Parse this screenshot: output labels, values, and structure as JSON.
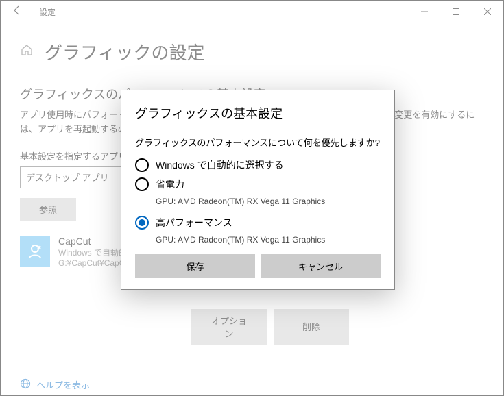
{
  "titlebar": {
    "title": "設定"
  },
  "page": {
    "heading": "グラフィックの設定",
    "section": "グラフィックスのパフォーマンスの基本設定",
    "desc": "アプリ使用時にパフォーマンスを向上させるために、アプリが使用するGPUを選択できます。変更を有効にするには、アプリを再起動する必要があります。",
    "choose_label": "基本設定を指定するアプリを選択します",
    "combo_value": "デスクトップ アプリ",
    "browse": "参照"
  },
  "app": {
    "name": "CapCut",
    "mode": "Windows で自動的に選択する",
    "path": "G:¥CapCut¥CapCut.exe"
  },
  "row_actions": {
    "options": "オプション",
    "remove": "削除"
  },
  "help": "ヘルプを表示",
  "modal": {
    "title": "グラフィックスの基本設定",
    "question": "グラフィックスのパフォーマンスについて何を優先しますか?",
    "opts": [
      {
        "label": "Windows で自動的に選択する",
        "sub": "",
        "selected": false
      },
      {
        "label": "省電力",
        "sub": "GPU: AMD Radeon(TM) RX Vega 11 Graphics",
        "selected": false
      },
      {
        "label": "高パフォーマンス",
        "sub": "GPU: AMD Radeon(TM) RX Vega 11 Graphics",
        "selected": true
      }
    ],
    "save": "保存",
    "cancel": "キャンセル"
  }
}
